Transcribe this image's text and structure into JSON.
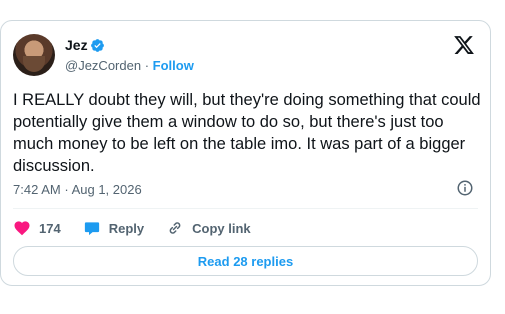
{
  "author": {
    "name": "Jez",
    "handle": "@JezCorden",
    "separator": "·",
    "follow_label": "Follow"
  },
  "post": {
    "text": "I REALLY doubt they will, but they're doing something that could potentially give them a window to do so, but there's just too much money to be left on the table imo. It was part of a bigger discussion.",
    "time": "7:42 AM",
    "separator": "·",
    "date": "Aug 1, 2026"
  },
  "actions": {
    "likes_count": "174",
    "reply_label": "Reply",
    "copy_link_label": "Copy link"
  },
  "read_replies_label": "Read 28 replies",
  "colors": {
    "accent": "#1d9bf0",
    "like": "#f91880",
    "muted": "#536471",
    "border": "#cfd9de"
  },
  "icons": [
    "verified-badge-icon",
    "x-logo-icon",
    "info-icon",
    "heart-icon",
    "reply-bubble-icon",
    "link-icon"
  ]
}
